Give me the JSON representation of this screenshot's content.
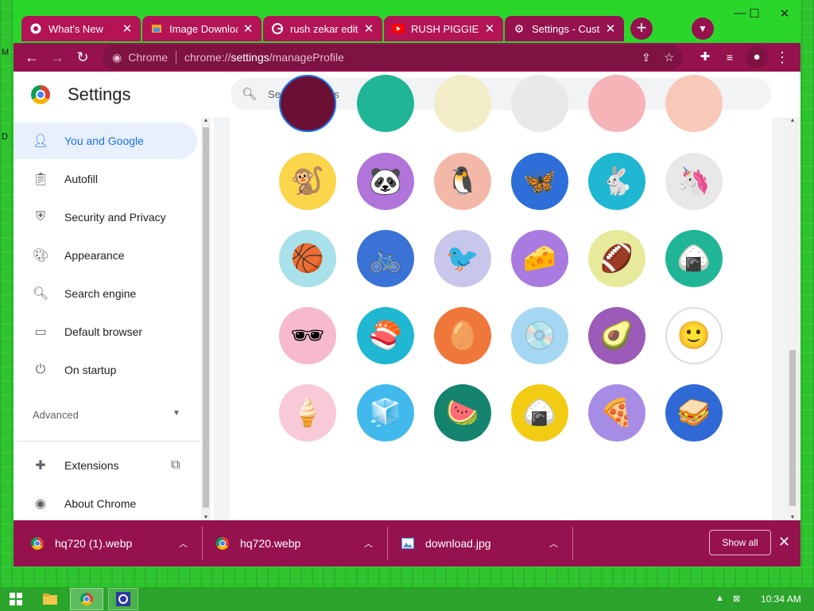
{
  "edge_text": [
    "M",
    "D"
  ],
  "tabs": [
    {
      "title": "What's New",
      "icon": "github-icon"
    },
    {
      "title": "Image Downloac",
      "icon": "image-downloader-icon"
    },
    {
      "title": "rush zekar editec",
      "icon": "google-icon"
    },
    {
      "title": "RUSH PIGGIES -",
      "icon": "youtube-icon"
    },
    {
      "title": "Settings - Custo",
      "icon": "settings-gear-icon",
      "active": true
    }
  ],
  "toolbar": {
    "chip": "Chrome",
    "url_scheme": "chrome://",
    "url_host": "settings",
    "url_path": "/manageProfile"
  },
  "settings": {
    "title": "Settings",
    "search_placeholder": "Search settings"
  },
  "sidebar": {
    "items": [
      {
        "label": "You and Google",
        "icon": "person-icon",
        "selected": true
      },
      {
        "label": "Autofill",
        "icon": "clipboard-icon"
      },
      {
        "label": "Security and Privacy",
        "icon": "shield-icon"
      },
      {
        "label": "Appearance",
        "icon": "palette-icon"
      },
      {
        "label": "Search engine",
        "icon": "search-icon"
      },
      {
        "label": "Default browser",
        "icon": "browser-window-icon"
      },
      {
        "label": "On startup",
        "icon": "power-icon"
      }
    ],
    "advanced": "Advanced",
    "extensions": "Extensions",
    "about": "About Chrome"
  },
  "avatars": [
    {
      "name": "monkey",
      "bg": "#fbd54a",
      "glyph": "🐒"
    },
    {
      "name": "panda",
      "bg": "#b074db",
      "glyph": "🐼"
    },
    {
      "name": "penguin",
      "bg": "#f3b8a8",
      "glyph": "🐧"
    },
    {
      "name": "butterfly",
      "bg": "#2d6ed8",
      "glyph": "🦋"
    },
    {
      "name": "rabbit",
      "bg": "#1fb7d1",
      "glyph": "🐇"
    },
    {
      "name": "unicorn",
      "bg": "#e8e8e8",
      "glyph": "🦄"
    },
    {
      "name": "basketball",
      "bg": "#a8e1ea",
      "glyph": "🏀"
    },
    {
      "name": "bike",
      "bg": "#3a72d6",
      "glyph": "🚲"
    },
    {
      "name": "bird",
      "bg": "#c9c6ec",
      "glyph": "🐦"
    },
    {
      "name": "cheese",
      "bg": "#a97be0",
      "glyph": "🧀"
    },
    {
      "name": "football",
      "bg": "#e6ea9a",
      "glyph": "🏈"
    },
    {
      "name": "sushi-plate",
      "bg": "#21b597",
      "glyph": "🍙"
    },
    {
      "name": "sunglasses",
      "bg": "#f6b9cf",
      "glyph": "🕶"
    },
    {
      "name": "sushi",
      "bg": "#1fb7d1",
      "glyph": "🍣"
    },
    {
      "name": "tamagotchi",
      "bg": "#f0773a",
      "glyph": "🥚"
    },
    {
      "name": "vinyl",
      "bg": "#a6d7f2",
      "glyph": "💿"
    },
    {
      "name": "avocado",
      "bg": "#9c5bb8",
      "glyph": "🥑"
    },
    {
      "name": "smiley",
      "bg": "#ffffff",
      "glyph": "🙂"
    },
    {
      "name": "ice-cream",
      "bg": "#f8c9d6",
      "glyph": "🍦"
    },
    {
      "name": "ice",
      "bg": "#41b9ec",
      "glyph": "🧊"
    },
    {
      "name": "watermelon",
      "bg": "#14846f",
      "glyph": "🍉"
    },
    {
      "name": "onigiri",
      "bg": "#f1cc12",
      "glyph": "🍙"
    },
    {
      "name": "pizza",
      "bg": "#a78ce6",
      "glyph": "🍕"
    },
    {
      "name": "sandwich",
      "bg": "#2f69d5",
      "glyph": "🥪"
    }
  ],
  "downloads": [
    {
      "name": "hq720 (1).webp",
      "icon": "chrome-icon"
    },
    {
      "name": "hq720.webp",
      "icon": "chrome-icon"
    },
    {
      "name": "download.jpg",
      "icon": "image-file-icon"
    }
  ],
  "show_all": "Show all",
  "clock": "10:34 AM",
  "colors": {
    "brand": "#95124e",
    "tab": "#b41456",
    "desktop": "#2ec42e",
    "accent": "#1a73e8"
  }
}
